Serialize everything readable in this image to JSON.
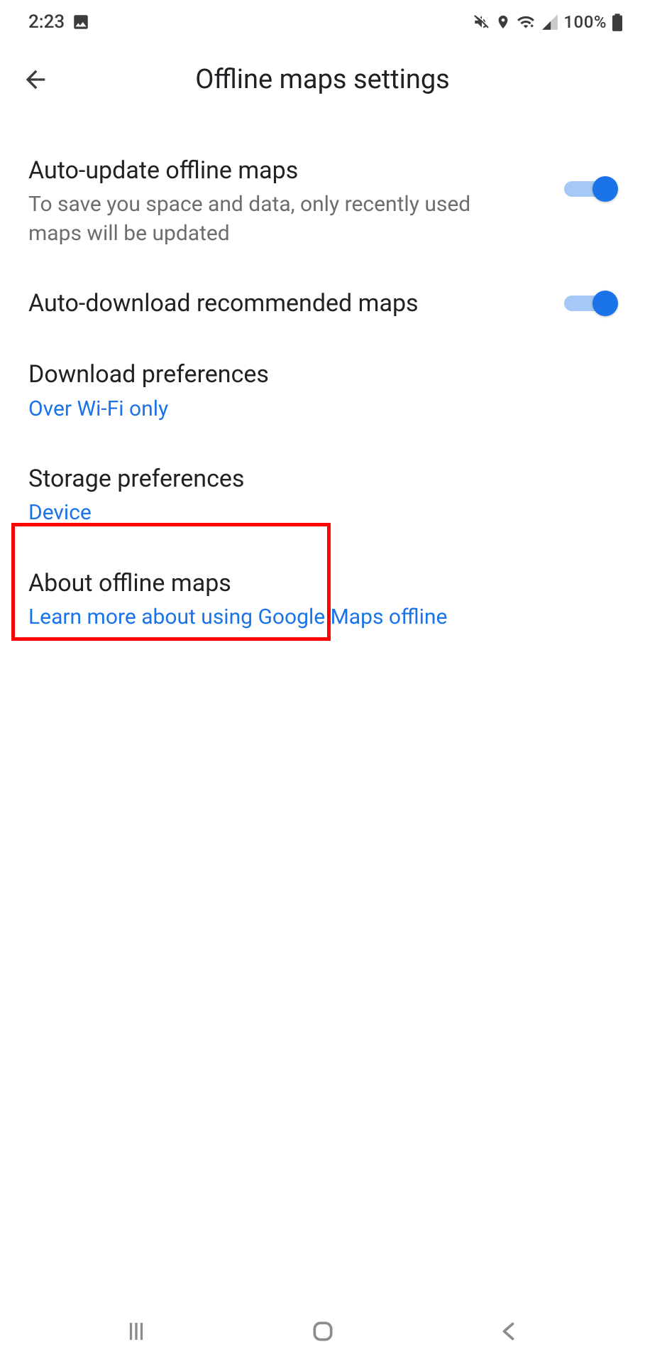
{
  "statusbar": {
    "time": "2:23",
    "battery_text": "100%"
  },
  "appbar": {
    "title": "Offline maps settings"
  },
  "settings": {
    "auto_update": {
      "title": "Auto-update offline maps",
      "subtitle": "To save you space and data, only recently used maps will be updated",
      "enabled": true
    },
    "auto_download": {
      "title": "Auto-download recommended maps",
      "enabled": true
    },
    "download_prefs": {
      "title": "Download preferences",
      "value": "Over Wi-Fi only"
    },
    "storage_prefs": {
      "title": "Storage preferences",
      "value": "Device"
    },
    "about": {
      "title": "About offline maps",
      "link_text": "Learn more about using Google Maps offline"
    }
  }
}
